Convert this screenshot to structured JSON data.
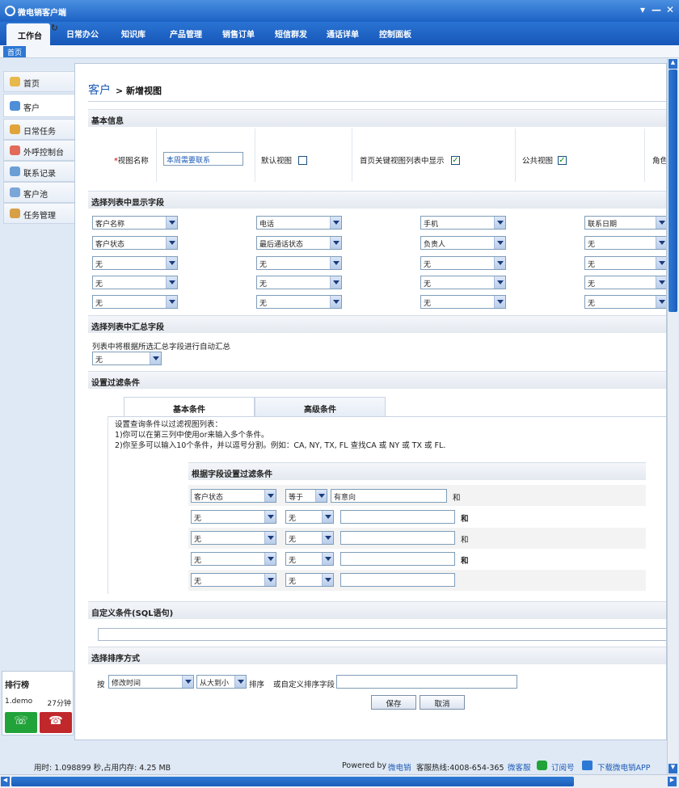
{
  "window": {
    "title": "微电销客户端",
    "btn_menu": "▾",
    "btn_min": "—",
    "btn_close": "✕"
  },
  "nav": {
    "tabs": [
      "工作台",
      "日常办公",
      "知识库",
      "产品管理",
      "销售订单",
      "短信群发",
      "通话详单",
      "控制面板"
    ]
  },
  "subbar": {
    "tab": "首页"
  },
  "sidebar": {
    "items": [
      "首页",
      "客户",
      "日常任务",
      "外呼控制台",
      "联系记录",
      "客户池",
      "任务管理"
    ]
  },
  "rank": {
    "title": "排行榜",
    "name": "1.demo",
    "time": "27分钟"
  },
  "page": {
    "title": "客户",
    "subtitle": "> 新增视图"
  },
  "basic": {
    "section": "基本信息",
    "name_label": "视图名称",
    "name_value": "本周需要联系",
    "default_view": "默认视图",
    "home_show": "首页关键视图列表中显示",
    "public_view": "公共视图",
    "role": "角色"
  },
  "columns": {
    "section": "选择列表中显示字段",
    "rows": [
      [
        "客户名称",
        "电话",
        "手机",
        "联系日期"
      ],
      [
        "客户状态",
        "最后通话状态",
        "负责人",
        "无"
      ],
      [
        "无",
        "无",
        "无",
        "无"
      ],
      [
        "无",
        "无",
        "无",
        "无"
      ],
      [
        "无",
        "无",
        "无",
        "无"
      ]
    ]
  },
  "summary": {
    "section": "选择列表中汇总字段",
    "desc": "列表中将根据所选汇总字段进行自动汇总",
    "value": "无"
  },
  "filter": {
    "section": "设置过滤条件",
    "tab_basic": "基本条件",
    "tab_advanced": "高级条件",
    "help1": "设置查询条件以过滤视图列表：",
    "help2": "1)你可以在第三列中使用or来输入多个条件。",
    "help3": "2)你至多可以输入10个条件，并以逗号分割。例如：CA, NY, TX, FL 查找CA 或 NY 或 TX 或 FL.",
    "table_title": "根据字段设置过滤条件",
    "rows": [
      {
        "field": "客户状态",
        "op": "等于",
        "value": "有意向",
        "join": "和"
      },
      {
        "field": "无",
        "op": "无",
        "value": "",
        "join": "和"
      },
      {
        "field": "无",
        "op": "无",
        "value": "",
        "join": "和"
      },
      {
        "field": "无",
        "op": "无",
        "value": "",
        "join": "和"
      },
      {
        "field": "无",
        "op": "无",
        "value": "",
        "join": ""
      }
    ]
  },
  "sql": {
    "section": "自定义条件(SQL语句)"
  },
  "sort": {
    "section": "选择排序方式",
    "by": "按",
    "field": "修改时间",
    "order": "从大到小",
    "sort_label": "排序",
    "custom_label": "或自定义排序字段",
    "save": "保存",
    "cancel": "取消"
  },
  "footer": {
    "stats": "用时: 1.098899 秒,占用内存: 4.25 MB",
    "powered": "Powered by",
    "brand": "微电销",
    "hotline": "客服热线:4008-654-365",
    "weibo": "微客服",
    "subscribe": "订阅号",
    "app": "下载微电销APP"
  },
  "colors": {
    "accent": "#1c62c6",
    "brand": "#1d5bb6",
    "green": "#21a33a",
    "red": "#c0282c"
  }
}
